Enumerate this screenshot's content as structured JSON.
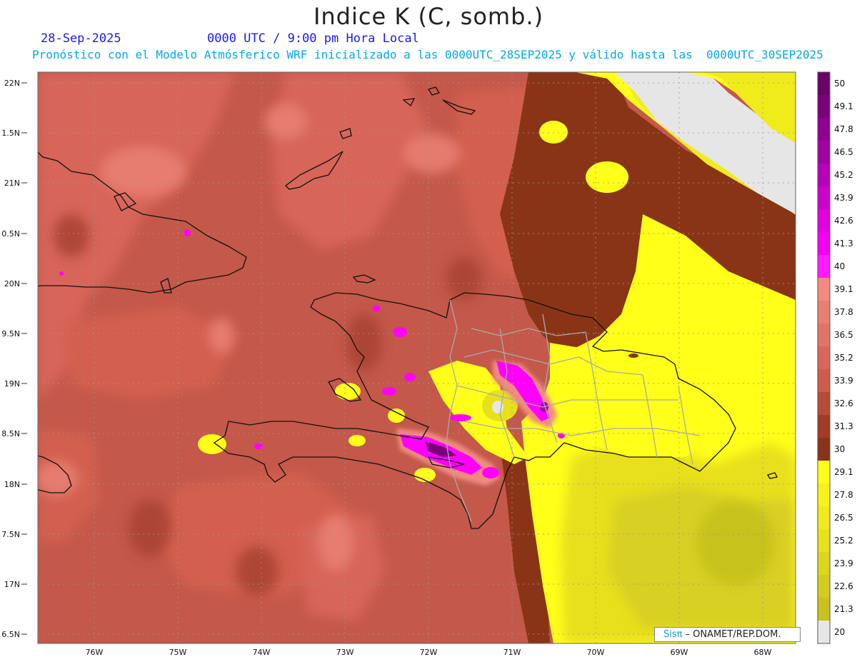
{
  "header": {
    "title": "Indice K (C, somb.)",
    "date": "28-Sep-2025",
    "time": "0000 UTC / 9:00 pm Hora Local",
    "description": "Pronóstico con el Modelo Atmósferico WRF inicializado a las 0000UTC_28SEP2025 y válido hasta las  0000UTC_30SEP2025"
  },
  "map": {
    "lat_labels": [
      "22N",
      "1.5N",
      "21N",
      "0.5N",
      "20N",
      "9.5N",
      "19N",
      "8.5N",
      "18N",
      "7.5N",
      "17N",
      "6.5N"
    ],
    "lon_labels": [
      "76W",
      "75W",
      "74W",
      "73W",
      "72W",
      "71W",
      "70W",
      "69W",
      "68W"
    ]
  },
  "colorbar": {
    "levels": [
      "50",
      "49.1",
      "47.8",
      "46.5",
      "45.2",
      "43.9",
      "42.6",
      "41.3",
      "40",
      "39.1",
      "37.8",
      "36.5",
      "35.2",
      "33.9",
      "32.6",
      "31.3",
      "30",
      "29.1",
      "27.8",
      "26.5",
      "25.2",
      "23.9",
      "22.6",
      "21.3",
      "20"
    ],
    "colors": {
      "purple_dark": "#6a006a",
      "magenta": "#ff00ff",
      "salmon_light": "#f28a80",
      "salmon": "#d9665a",
      "brown_red": "#c4584a",
      "brown_dark": "#8a3417",
      "yellow": "#ffff1a",
      "olive": "#c8c21e",
      "gray": "#e6e6e6"
    }
  },
  "credit": {
    "sis": "Sisπ",
    "text": "– ONAMET/REP.DOM."
  }
}
